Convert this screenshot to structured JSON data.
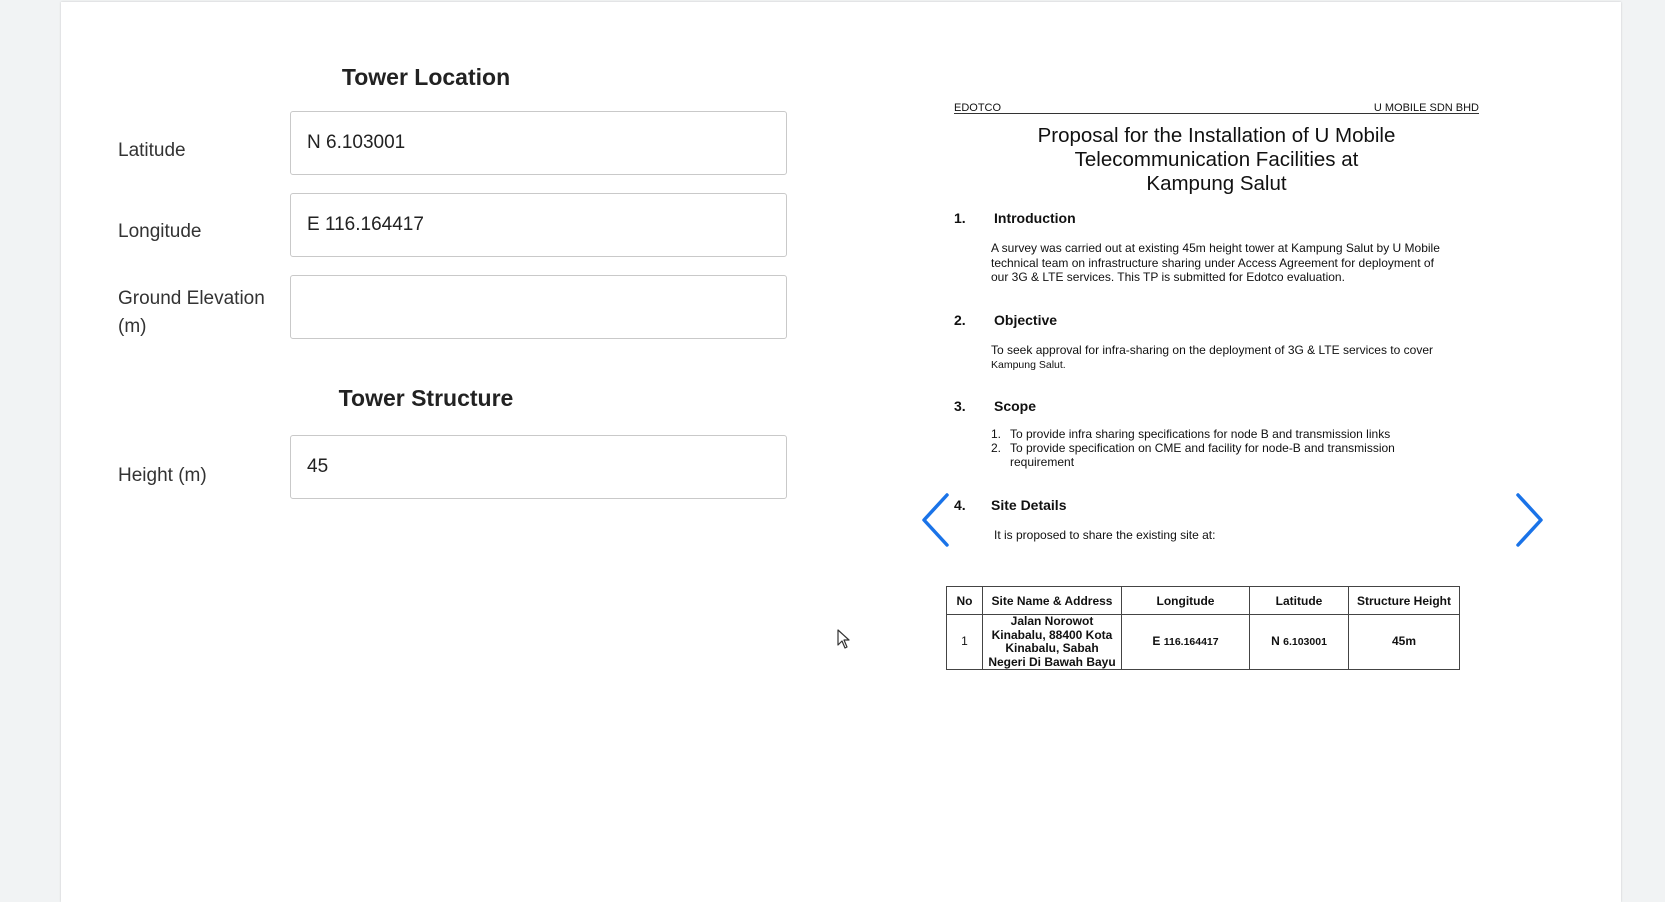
{
  "form": {
    "location_title": "Tower Location",
    "latitude_label": "Latitude",
    "latitude_value": "N 6.103001",
    "longitude_label": "Longitude",
    "longitude_value": "E 116.164417",
    "elevation_label_line1": "Ground Elevation",
    "elevation_label_line2": "(m)",
    "elevation_value": "",
    "structure_title": "Tower Structure",
    "height_label": "Height (m)",
    "height_value": "45"
  },
  "document": {
    "header_left": "EDOTCO",
    "header_right": "U MOBILE SDN BHD",
    "title_lines": [
      "Proposal for the Installation of U Mobile",
      "Telecommunication Facilities at",
      "Kampung Salut"
    ],
    "sections": [
      {
        "num": "1.",
        "title": "Introduction",
        "lines": [
          "A survey was carried out at existing 45m height tower at Kampung Salut by U Mobile",
          "technical team on infrastructure sharing under Access Agreement for deployment of",
          "our 3G & LTE services. This TP is submitted for Edotco evaluation."
        ]
      },
      {
        "num": "2.",
        "title": "Objective",
        "lines": [
          "To seek approval for infra-sharing on the deployment of 3G & LTE services to cover",
          "Kampung Salut."
        ]
      },
      {
        "num": "3.",
        "title": "Scope",
        "items": [
          {
            "n": "1.",
            "text": "To provide infra sharing specifications for node B and transmission links"
          },
          {
            "n": "2.",
            "text": "To provide specification on CME and facility for node-B and transmission"
          },
          {
            "n": "",
            "text": "requirement"
          }
        ]
      },
      {
        "num": "4.",
        "title": "Site Details",
        "lines": [
          "It is proposed to share the existing site at:"
        ]
      }
    ],
    "table": {
      "headers": [
        "No",
        "Site Name & Address",
        "Longitude",
        "Latitude",
        "Structure Height"
      ],
      "row": {
        "no": "1",
        "address_lines": [
          "Jalan Norowot",
          "Kinabalu, 88400 Kota",
          "Kinabalu, Sabah",
          "Negeri Di Bawah Bayu"
        ],
        "longitude_prefix": "E",
        "longitude": "116.164417",
        "latitude_prefix": "N",
        "latitude": "6.103001",
        "height": "45m"
      }
    }
  },
  "nav": {
    "prev_icon": "chevron-left-icon",
    "next_icon": "chevron-right-icon",
    "arrow_color": "#1a73e8"
  }
}
